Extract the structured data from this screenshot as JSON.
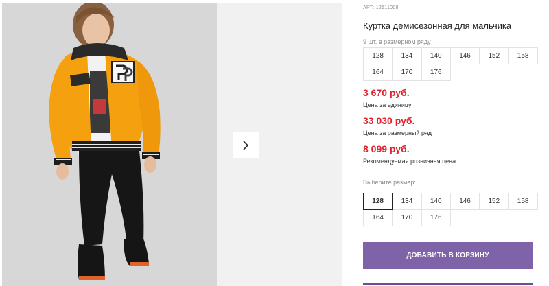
{
  "product": {
    "article": "АРТ: 12511008",
    "title": "Куртка демисезонная для мальчика",
    "pack_label": "9 шт. в размерном ряду",
    "pack_sizes": [
      "128",
      "134",
      "140",
      "146",
      "152",
      "158",
      "164",
      "170",
      "176"
    ]
  },
  "prices": {
    "unit_price": "3 670 руб.",
    "unit_label": "Цена за единицу",
    "pack_price": "33 030 руб.",
    "pack_label": "Цена за размерный ряд",
    "retail_price": "8 099 руб.",
    "retail_label": "Рекомендуемая розничная цена"
  },
  "size_picker": {
    "label": "Выберите размер:",
    "sizes": [
      "128",
      "134",
      "140",
      "146",
      "152",
      "158",
      "164",
      "170",
      "176"
    ],
    "selected": "128"
  },
  "cart": {
    "add_label": "ДОБАВИТЬ В КОРЗИНУ"
  },
  "colors": {
    "price": "#e0232d",
    "button": "#7e63a8",
    "jacket": "#f5a00f"
  },
  "icons": {
    "next": "chevron-right-icon"
  }
}
